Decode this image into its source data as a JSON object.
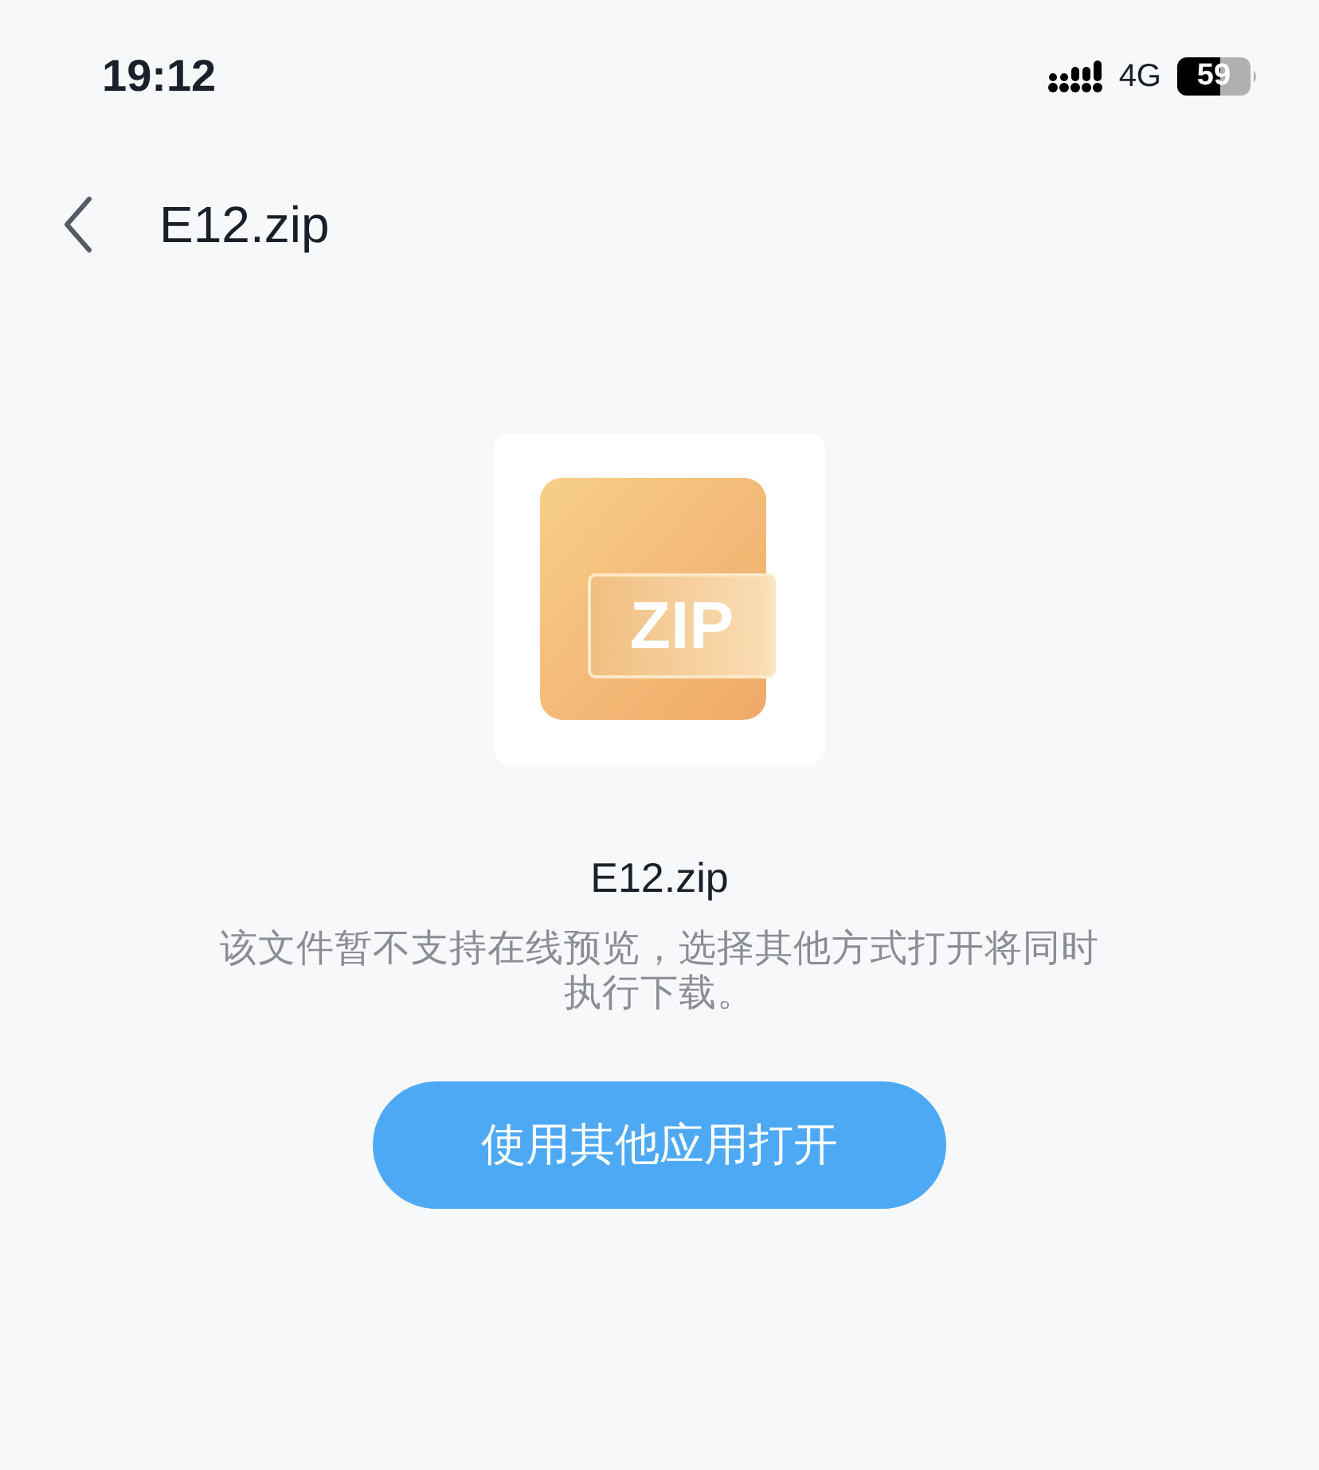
{
  "status_bar": {
    "time": "19:12",
    "network": "4G",
    "battery": "59"
  },
  "nav": {
    "title": "E12.zip"
  },
  "file": {
    "badge": "ZIP",
    "name": "E12.zip",
    "message": "该文件暂不支持在线预览，选择其他方式打开将同时执行下载。"
  },
  "button": {
    "label": "使用其他应用打开"
  }
}
